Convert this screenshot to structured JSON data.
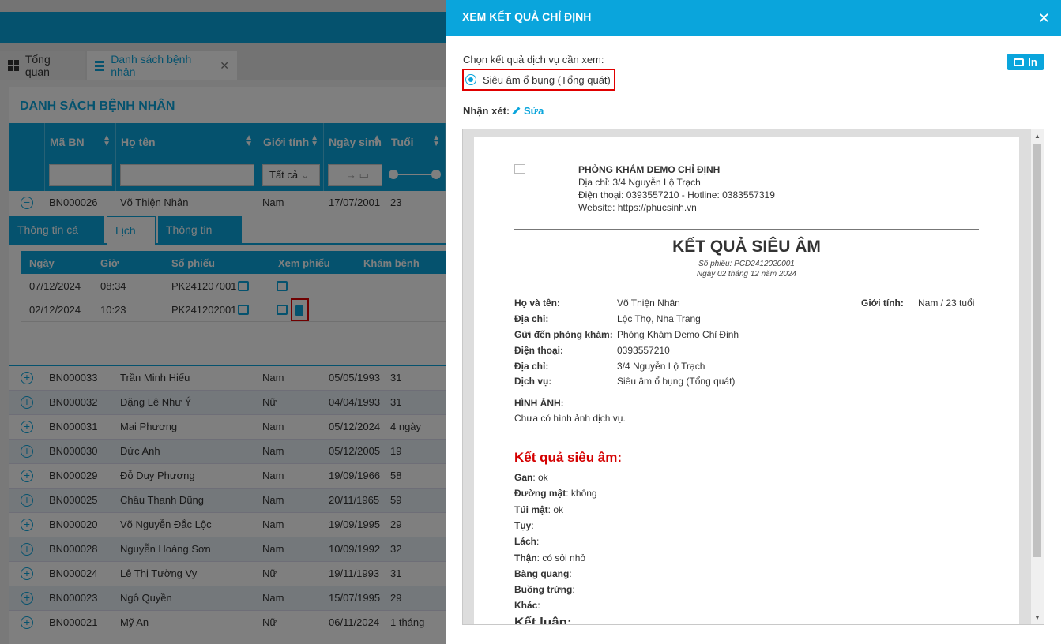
{
  "tabs": [
    {
      "label": "Tổng quan"
    },
    {
      "label": "Danh sách bệnh nhân"
    }
  ],
  "page_title": "DANH SÁCH BỆNH NHÂN",
  "grid": {
    "columns": {
      "ma_bn": "Mã BN",
      "ho_ten": "Họ tên",
      "gioi_tinh": "Giới tính",
      "ngay_sinh": "Ngày sinh",
      "tuoi": "Tuổi"
    },
    "filters": {
      "gioi_tinh": "Tất cả",
      "date_arrow": "→"
    },
    "expanded_row": {
      "ma": "BN000026",
      "ten": "Võ Thiện Nhân",
      "gt": "Nam",
      "ns": "17/07/2001",
      "tuoi": "23"
    },
    "rows": [
      {
        "ma": "BN000033",
        "ten": "Trần Minh Hiếu",
        "gt": "Nam",
        "ns": "05/05/1993",
        "tuoi": "31"
      },
      {
        "ma": "BN000032",
        "ten": "Đặng Lê Như Ý",
        "gt": "Nữ",
        "ns": "04/04/1993",
        "tuoi": "31"
      },
      {
        "ma": "BN000031",
        "ten": "Mai Phương",
        "gt": "Nam",
        "ns": "05/12/2024",
        "tuoi": "4 ngày"
      },
      {
        "ma": "BN000030",
        "ten": "Đức Anh",
        "gt": "Nam",
        "ns": "05/12/2005",
        "tuoi": "19"
      },
      {
        "ma": "BN000029",
        "ten": "Đỗ Duy Phương",
        "gt": "Nam",
        "ns": "19/09/1966",
        "tuoi": "58"
      },
      {
        "ma": "BN000025",
        "ten": "Châu Thanh Dũng",
        "gt": "Nam",
        "ns": "20/11/1965",
        "tuoi": "59"
      },
      {
        "ma": "BN000020",
        "ten": "Võ Nguyễn Đắc Lộc",
        "gt": "Nam",
        "ns": "19/09/1995",
        "tuoi": "29"
      },
      {
        "ma": "BN000028",
        "ten": "Nguyễn Hoàng Sơn",
        "gt": "Nam",
        "ns": "10/09/1992",
        "tuoi": "32"
      },
      {
        "ma": "BN000024",
        "ten": "Lê Thị Tường Vy",
        "gt": "Nữ",
        "ns": "19/11/1993",
        "tuoi": "31"
      },
      {
        "ma": "BN000023",
        "ten": "Ngô Quyền",
        "gt": "Nam",
        "ns": "15/07/1995",
        "tuoi": "29"
      },
      {
        "ma": "BN000021",
        "ten": "Mỹ An",
        "gt": "Nữ",
        "ns": "06/11/2024",
        "tuoi": "1 tháng"
      }
    ]
  },
  "detail": {
    "subtabs": [
      "Thông tin cá nhân",
      "Lịch sử",
      "Thông tin khác"
    ],
    "hist_cols": {
      "ngay": "Ngày",
      "gio": "Giờ",
      "so_phieu": "Số phiếu",
      "xem_phieu": "Xem phiếu",
      "kham_benh": "Khám bệnh"
    },
    "hist_rows": [
      {
        "ngay": "07/12/2024",
        "gio": "08:34",
        "so_phieu": "PK241207001"
      },
      {
        "ngay": "02/12/2024",
        "gio": "10:23",
        "so_phieu": "PK241202001"
      }
    ]
  },
  "panel": {
    "title": "XEM KẾT QUẢ CHỈ ĐỊNH",
    "choose_label": "Chọn kết quả dịch vụ cần xem:",
    "print_label": "In",
    "option": "Siêu âm ổ bụng (Tổng quát)",
    "comment_label": "Nhận xét:",
    "edit_label": "Sửa"
  },
  "report": {
    "clinic": {
      "name": "PHÒNG KHÁM DEMO CHỈ ĐỊNH",
      "address": "Địa chỉ: 3/4 Nguyễn Lộ Trạch",
      "phone": "Điện thoại: 0393557210 - Hotline: 0383557319",
      "website": "Website: https://phucsinh.vn"
    },
    "title": "KẾT QUẢ SIÊU ÂM",
    "so_phieu": "Số phiếu: PCD2412020001",
    "date": "Ngày 02 tháng 12 năm 2024",
    "fields": {
      "ho_ten_l": "Họ và tên:",
      "ho_ten_v": "Võ Thiện Nhân",
      "gioi_tinh_l": "Giới tính:",
      "gioi_tinh_v": "Nam / 23 tuổi",
      "dia_chi_l": "Địa chỉ:",
      "dia_chi_v": "Lộc Thọ, Nha Trang",
      "gui_den_l": "Gửi đến phòng khám:",
      "gui_den_v": "Phòng Khám Demo Chỉ Định",
      "dien_thoai_l": "Điện thoại:",
      "dien_thoai_v": "0393557210",
      "dia_chi2_l": "Địa chỉ:",
      "dia_chi2_v": "3/4 Nguyễn Lộ Trạch",
      "dich_vu_l": "Dịch vụ:",
      "dich_vu_v": "Siêu âm ổ bụng (Tổng quát)"
    },
    "image_label": "HÌNH ẢNH:",
    "image_none": "Chưa có hình ảnh dịch vụ.",
    "result_title": "Kết quả siêu âm:",
    "results": {
      "gan_l": "Gan",
      "gan_v": ": ok",
      "duong_mat_l": "Đường mật",
      "duong_mat_v": ": không",
      "tui_mat_l": "Túi mật",
      "tui_mat_v": ": ok",
      "tuy_l": "Tụy",
      "tuy_v": ":",
      "lach_l": "Lách",
      "lach_v": ":",
      "than_l": "Thận",
      "than_v": ": có sỏi nhỏ",
      "bang_quang_l": "Bàng quang",
      "bang_quang_v": ":",
      "buong_trung_l": "Buồng trứng",
      "buong_trung_v": ":",
      "khac_l": "Khác",
      "khac_v": ":"
    },
    "conclusion_label": "Kết luận:"
  }
}
